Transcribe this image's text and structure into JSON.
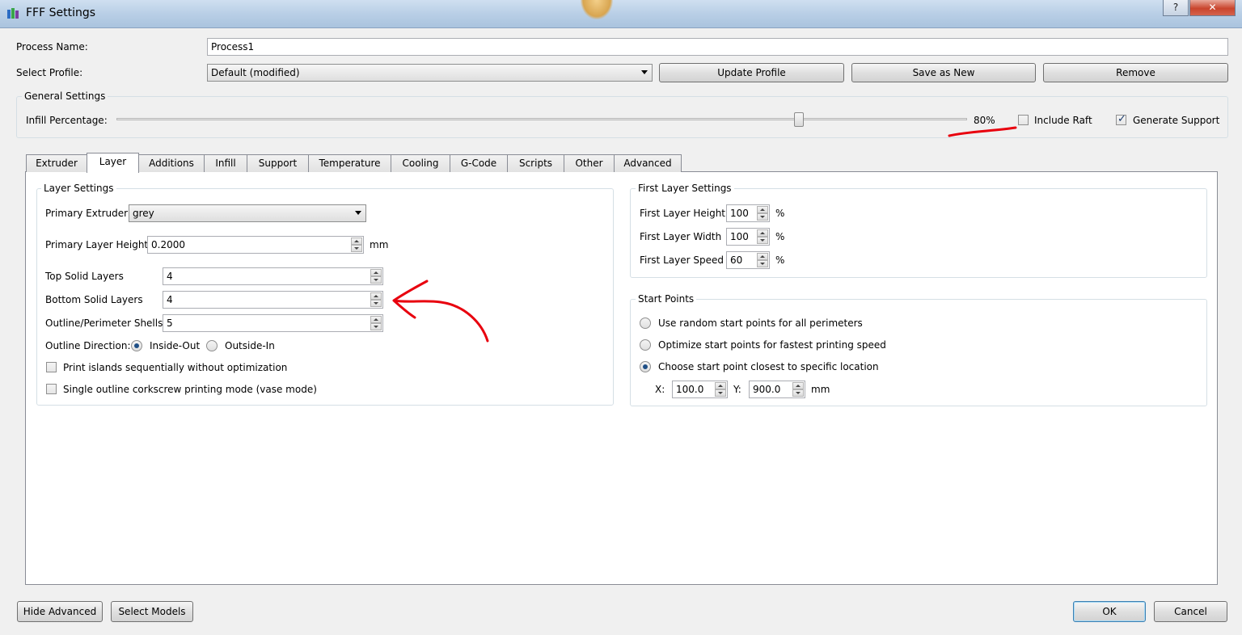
{
  "window": {
    "title": "FFF Settings",
    "help_label": "?",
    "close_label": "✕"
  },
  "process": {
    "name_label": "Process Name:",
    "name_value": "Process1"
  },
  "profile": {
    "select_label": "Select Profile:",
    "selected": "Default (modified)",
    "update_label": "Update Profile",
    "save_new_label": "Save as New",
    "remove_label": "Remove"
  },
  "general": {
    "title": "General Settings",
    "infill_label": "Infill Percentage:",
    "infill_value_text": "80%",
    "infill_level": 0.8,
    "include_raft_label": "Include Raft",
    "include_raft_checked": false,
    "generate_support_label": "Generate Support",
    "generate_support_checked": true
  },
  "tabs": [
    {
      "label": "Extruder"
    },
    {
      "label": "Layer",
      "active": true
    },
    {
      "label": "Additions"
    },
    {
      "label": "Infill"
    },
    {
      "label": "Support"
    },
    {
      "label": "Temperature"
    },
    {
      "label": "Cooling"
    },
    {
      "label": "G-Code"
    },
    {
      "label": "Scripts"
    },
    {
      "label": "Other"
    },
    {
      "label": "Advanced"
    }
  ],
  "layer_settings": {
    "title": "Layer Settings",
    "primary_extruder_label": "Primary Extruder",
    "primary_extruder_value": "grey",
    "primary_layer_height_label": "Primary Layer Height",
    "primary_layer_height_value": "0.2000",
    "primary_layer_height_unit": "mm",
    "top_solid_label": "Top Solid Layers",
    "top_solid_value": "4",
    "bottom_solid_label": "Bottom Solid Layers",
    "bottom_solid_value": "4",
    "outline_shells_label": "Outline/Perimeter Shells",
    "outline_shells_value": "5",
    "outline_direction_label": "Outline Direction:",
    "inside_out_label": "Inside-Out",
    "outside_in_label": "Outside-In",
    "print_islands_label": "Print islands sequentially without optimization",
    "vase_mode_label": "Single outline corkscrew printing mode (vase mode)"
  },
  "first_layer": {
    "title": "First Layer Settings",
    "height_label": "First Layer Height",
    "height_value": "100",
    "height_unit": "%",
    "width_label": "First Layer Width",
    "width_value": "100",
    "width_unit": "%",
    "speed_label": "First Layer Speed",
    "speed_value": "60",
    "speed_unit": "%"
  },
  "start_points": {
    "title": "Start Points",
    "option_random": "Use random start points for all perimeters",
    "option_optimize": "Optimize start points for fastest printing speed",
    "option_closest": "Choose start point closest to specific location",
    "x_label": "X:",
    "x_value": "100.0",
    "y_label": "Y:",
    "y_value": "900.0",
    "unit": "mm"
  },
  "footer": {
    "hide_advanced_label": "Hide Advanced",
    "select_models_label": "Select Models",
    "ok_label": "OK",
    "cancel_label": "Cancel"
  },
  "colors": {
    "annotation": "#e8000e",
    "titlebar": "#b9cfe6",
    "accent": "#3c7fb1"
  }
}
